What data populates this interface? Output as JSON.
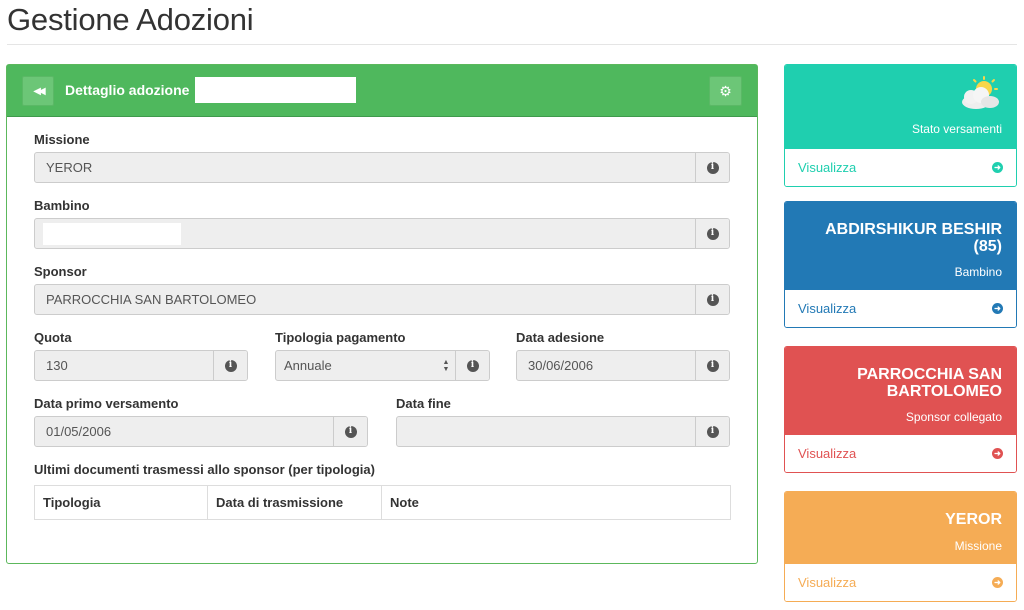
{
  "page": {
    "title": "Gestione Adozioni"
  },
  "panel": {
    "title": "Dettaglio adozione",
    "back_icon": "double-chevron-left-icon",
    "settings_icon": "gear-icon"
  },
  "form": {
    "missione": {
      "label": "Missione",
      "value": "YEROR"
    },
    "bambino": {
      "label": "Bambino",
      "value": ""
    },
    "sponsor": {
      "label": "Sponsor",
      "value": "PARROCCHIA SAN BARTOLOMEO"
    },
    "quota": {
      "label": "Quota",
      "value": "130"
    },
    "tipologia_pagamento": {
      "label": "Tipologia pagamento",
      "value": "Annuale"
    },
    "data_adesione": {
      "label": "Data adesione",
      "value": "30/06/2006"
    },
    "data_primo_versamento": {
      "label": "Data primo versamento",
      "value": "01/05/2006"
    },
    "data_fine": {
      "label": "Data fine",
      "value": ""
    }
  },
  "documents": {
    "title": "Ultimi documenti trasmessi allo sponsor (per tipologia)",
    "columns": [
      "Tipologia",
      "Data di trasmissione",
      "Note"
    ],
    "rows": []
  },
  "widgets": [
    {
      "title": "",
      "subtitle": "Stato versamenti",
      "link": "Visualizza",
      "icon": "partly-cloudy-weather-icon",
      "color": "#1fcfaf"
    },
    {
      "title": "ABDIRSHIKUR BESHIR (85)",
      "subtitle": "Bambino",
      "link": "Visualizza",
      "color": "#2279b5"
    },
    {
      "title": "PARROCCHIA SAN BARTOLOMEO",
      "subtitle": "Sponsor collegato",
      "link": "Visualizza",
      "color": "#e05252"
    },
    {
      "title": "YEROR",
      "subtitle": "Missione",
      "link": "Visualizza",
      "color": "#f5ac55"
    }
  ]
}
